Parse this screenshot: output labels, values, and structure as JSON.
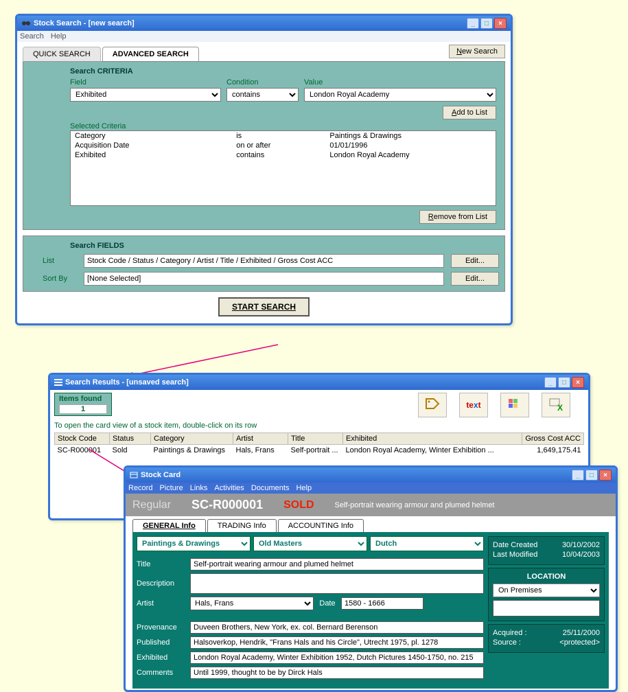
{
  "search_window": {
    "title": "Stock Search - [new search]",
    "menu": [
      "Search",
      "Help"
    ],
    "tabs": {
      "quick": "QUICK SEARCH",
      "advanced": "ADVANCED SEARCH"
    },
    "new_search": "New Search",
    "criteria_heading": "Search CRITERIA",
    "labels": {
      "field": "Field",
      "condition": "Condition",
      "value": "Value",
      "selected": "Selected Criteria"
    },
    "field": "Exhibited",
    "condition": "contains",
    "value": "London Royal Academy",
    "add_to_list": "Add to List",
    "selected_criteria": [
      {
        "field": "Category",
        "cond": "is",
        "val": "Paintings & Drawings"
      },
      {
        "field": "Acquisition Date",
        "cond": "on or after",
        "val": "01/01/1996"
      },
      {
        "field": "Exhibited",
        "cond": "contains",
        "val": "London Royal Academy"
      }
    ],
    "remove_from_list": "Remove from List",
    "fields_heading": "Search FIELDS",
    "list_label": "List",
    "list_value": "Stock Code / Status / Category / Artist / Title / Exhibited / Gross Cost ACC",
    "sortby_label": "Sort By",
    "sortby_value": "[None Selected]",
    "edit": "Edit...",
    "start_search": "START SEARCH"
  },
  "results_window": {
    "title": "Search Results - [unsaved search]",
    "items_found_label": "Items found",
    "items_found": "1",
    "hint": "To open the card view of a stock item, double-click on its row",
    "columns": [
      "Stock Code",
      "Status",
      "Category",
      "Artist",
      "Title",
      "Exhibited",
      "Gross Cost ACC"
    ],
    "rows": [
      {
        "code": "SC-R000001",
        "status": "Sold",
        "category": "Paintings & Drawings",
        "artist": "Hals, Frans",
        "title": "Self-portrait ...",
        "exhibited": "London Royal Academy, Winter Exhibition ...",
        "cost": "1,649,175.41"
      }
    ],
    "icons": [
      "tag-icon",
      "text-search-icon",
      "grid-icon",
      "excel-icon"
    ]
  },
  "card_window": {
    "title": "Stock Card",
    "menu": [
      "Record",
      "Picture",
      "Links",
      "Activities",
      "Documents",
      "Help"
    ],
    "regular": "Regular",
    "code": "SC-R000001",
    "status": "SOLD",
    "header_desc": "Self-portrait wearing armour and plumed helmet",
    "tabs": {
      "general": "GENERAL Info",
      "trading": "TRADING Info",
      "accounting": "ACCOUNTING Info"
    },
    "category1": "Paintings & Drawings",
    "category2": "Old Masters",
    "category3": "Dutch",
    "fields": {
      "title_lbl": "Title",
      "title": "Self-portrait wearing armour and plumed helmet",
      "desc_lbl": "Description",
      "desc": "",
      "artist_lbl": "Artist",
      "artist": "Hals, Frans",
      "date_lbl": "Date",
      "date": "1580 - 1666",
      "prov_lbl": "Provenance",
      "prov": "Duveen Brothers, New York, ex. col. Bernard Berenson",
      "pub_lbl": "Published",
      "pub": "Halsoverkop, Hendrik, \"Frans Hals and his Circle\", Utrecht 1975, pl. 1278",
      "exh_lbl": "Exhibited",
      "exh": "London Royal Academy, Winter Exhibition 1952, Dutch Pictures 1450-1750, no. 215",
      "comm_lbl": "Comments",
      "comm": "Until 1999, thought to be by Dirck Hals"
    },
    "side": {
      "created_lbl": "Date Created",
      "created": "30/10/2002",
      "modified_lbl": "Last Modified",
      "modified": "10/04/2003",
      "location_title": "LOCATION",
      "location": "On Premises",
      "acquired_lbl": "Acquired :",
      "acquired": "25/11/2000",
      "source_lbl": "Source :",
      "source": "<protected>"
    }
  }
}
